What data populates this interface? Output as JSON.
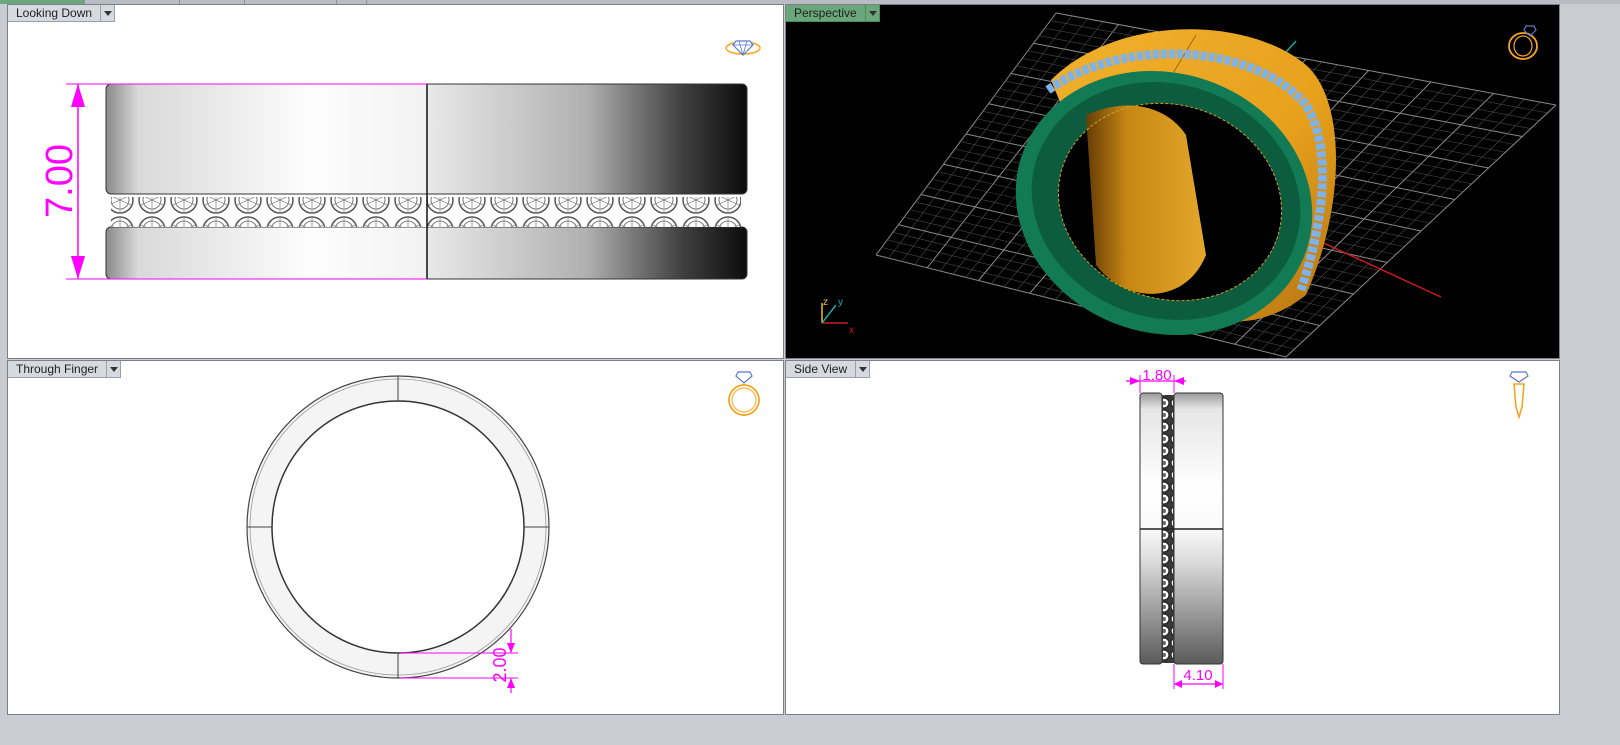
{
  "viewports": {
    "top": {
      "label": "Looking Down",
      "dimension": "7.00"
    },
    "perspective": {
      "label": "Perspective",
      "axis_x": "x",
      "axis_y": "y",
      "axis_z": "z"
    },
    "front": {
      "label": "Through Finger",
      "dimension": "2.00"
    },
    "side": {
      "label": "Side View",
      "dimension_top": "1.80",
      "dimension_bottom": "4.10"
    }
  },
  "colors": {
    "accent_label": "#6aa77a",
    "dimension": "#ff00ff",
    "metal_gold": "#e8a21a",
    "metal_green": "#127a55",
    "stones": "#7fb2e8",
    "icon": "#f5a623"
  },
  "icons": {
    "top": "ring-gem-icon",
    "perspective": "ring-gem-icon",
    "front": "ring-front-icon",
    "side": "ring-side-icon"
  }
}
